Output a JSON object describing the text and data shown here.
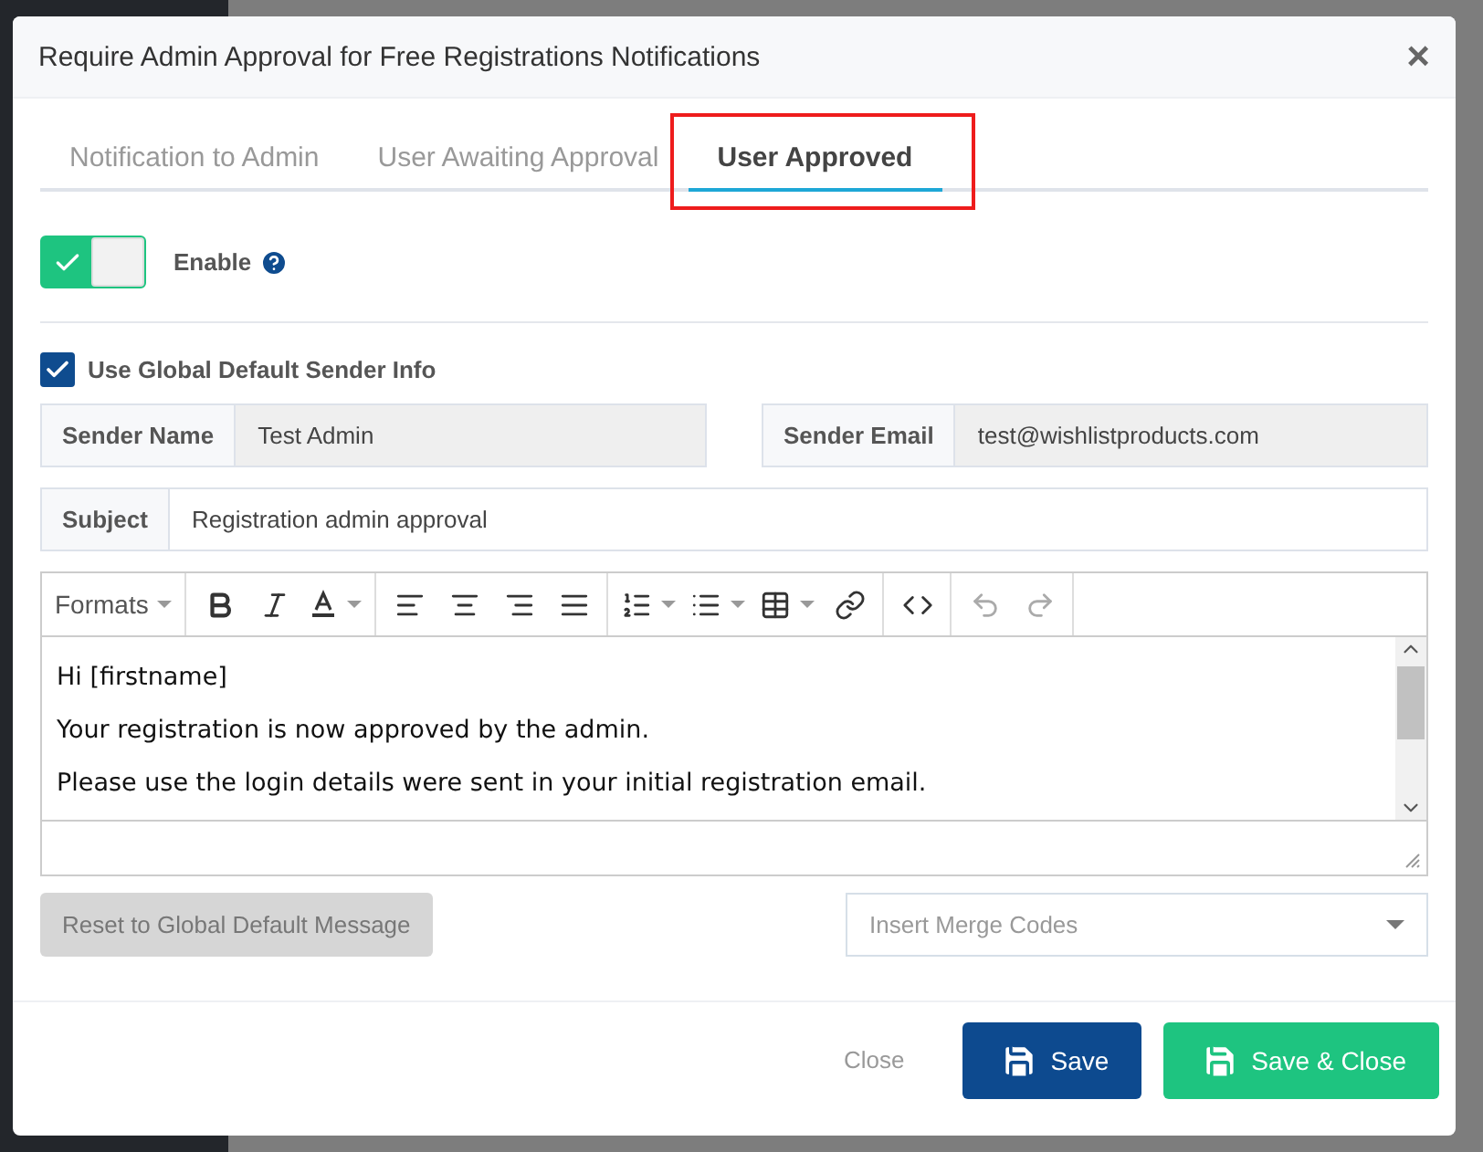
{
  "modal": {
    "title": "Require Admin Approval for Free Registrations Notifications",
    "close": "×"
  },
  "tabs": [
    {
      "label": "Notification to Admin",
      "selected": false,
      "highlighted": false
    },
    {
      "label": "User Awaiting Approval",
      "selected": false,
      "highlighted": false
    },
    {
      "label": "User Approved",
      "selected": true,
      "highlighted": true
    }
  ],
  "enable": {
    "label": "Enable",
    "on": true
  },
  "use_global": {
    "label": "Use Global Default Sender Info",
    "checked": true
  },
  "sender_name": {
    "label": "Sender Name",
    "value": "Test Admin",
    "disabled": true
  },
  "sender_email": {
    "label": "Sender Email",
    "value": "test@wishlistproducts.com",
    "disabled": true
  },
  "subject": {
    "label": "Subject",
    "value": "Registration admin approval",
    "disabled": false
  },
  "editor": {
    "formats": "Formats",
    "tools": [
      {
        "kind": "bold",
        "disabled": false
      },
      {
        "kind": "italic",
        "disabled": false
      },
      {
        "kind": "color",
        "disabled": false
      },
      {
        "kind": "align-left",
        "disabled": false
      },
      {
        "kind": "align-center",
        "disabled": false
      },
      {
        "kind": "align-right",
        "disabled": false
      },
      {
        "kind": "justify",
        "disabled": false
      },
      {
        "kind": "numbered-list",
        "disabled": false
      },
      {
        "kind": "bulleted-list",
        "disabled": false
      },
      {
        "kind": "table",
        "disabled": false
      },
      {
        "kind": "link",
        "disabled": false
      },
      {
        "kind": "code",
        "disabled": false
      },
      {
        "kind": "undo",
        "disabled": true
      },
      {
        "kind": "redo",
        "disabled": true
      }
    ],
    "lines": [
      "Hi [firstname]",
      "Your registration is now approved by the admin.",
      "Please use the login details were sent in your initial registration email."
    ]
  },
  "reset_button": {
    "label": "Reset to Global Default Message",
    "disabled": true
  },
  "merge_codes": {
    "placeholder": "Insert Merge Codes"
  },
  "footer": {
    "close": "Close",
    "save": "Save",
    "save_close": "Save & Close"
  }
}
